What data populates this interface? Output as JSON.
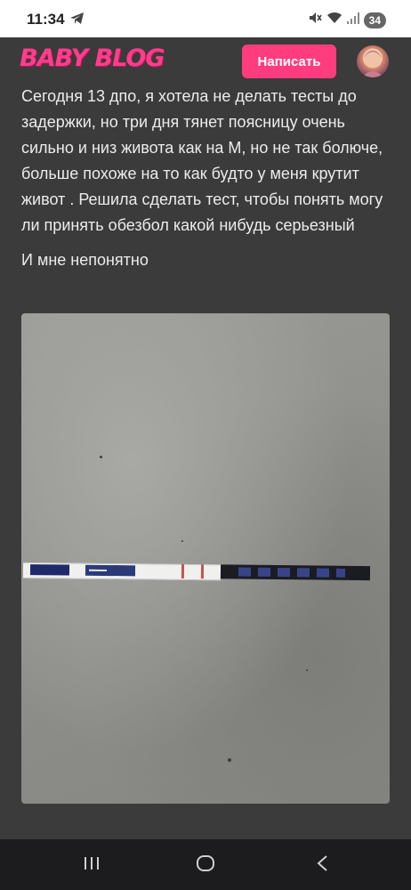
{
  "status_bar": {
    "time": "11:34",
    "battery": "34"
  },
  "header": {
    "logo": "BABY BLOG",
    "write_button": "Написать"
  },
  "post": {
    "paragraph_1": "Сегодня 13 дпо, я хотела не делать тесты до задержки, но три дня тянет поясницу очень сильно и низ живота как на М, но не так болюче, больше похоже на то как будто у меня крутит живот . Решила сделать тест, чтобы понять могу ли принять обезбол какой нибудь серьезный",
    "paragraph_2": "И мне непонятно",
    "photo_strip_texts": [
      "SAMPLE",
      "MAX",
      "HCG HCG HCG"
    ]
  },
  "nav_bar": {
    "icons": [
      "recent-apps-icon",
      "home-icon",
      "back-icon"
    ]
  },
  "colors": {
    "brand": "#ff3d8b",
    "button": "#ff3d7e",
    "background": "#3b3b3b"
  }
}
